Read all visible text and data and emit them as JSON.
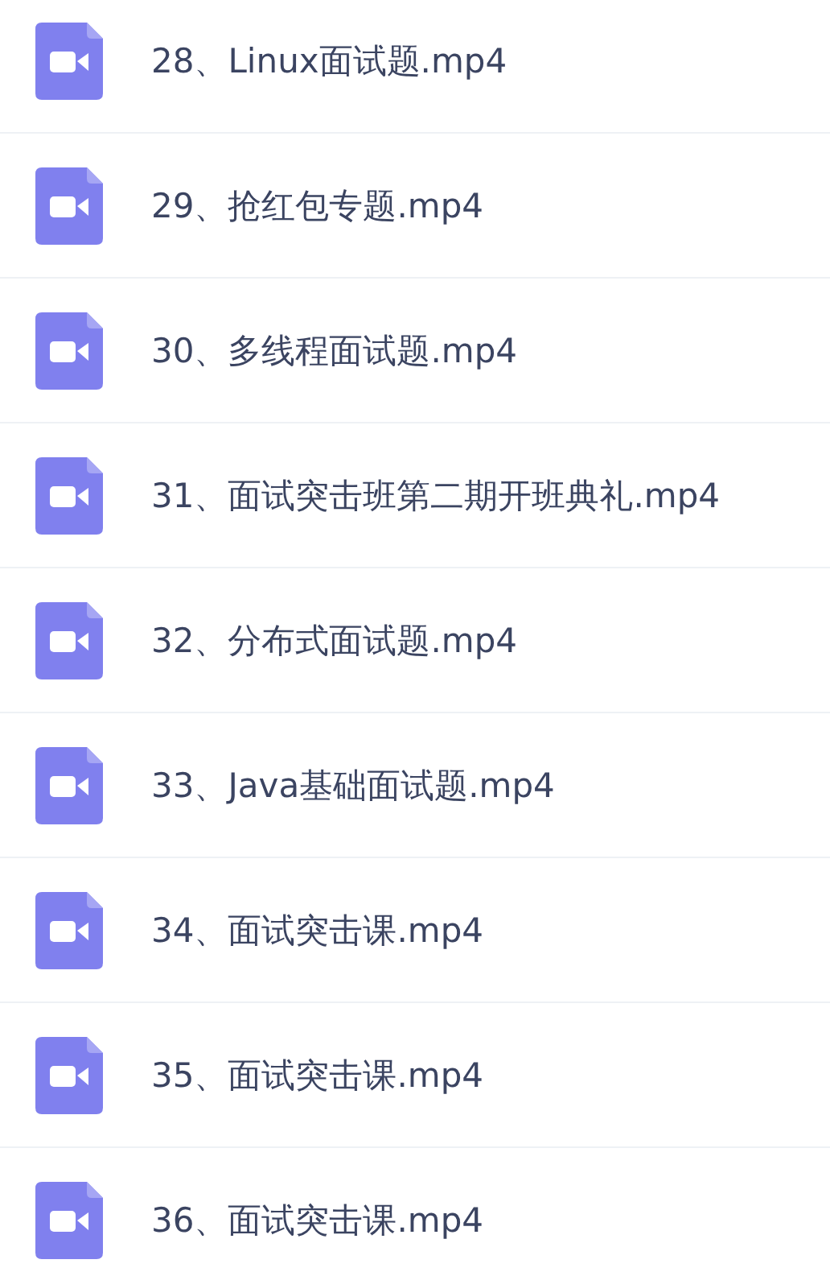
{
  "files": [
    {
      "name": "28、Linux面试题.mp4",
      "kind": "video"
    },
    {
      "name": "29、抢红包专题.mp4",
      "kind": "video"
    },
    {
      "name": "30、多线程面试题.mp4",
      "kind": "video"
    },
    {
      "name": "31、面试突击班第二期开班典礼.mp4",
      "kind": "video"
    },
    {
      "name": "32、分布式面试题.mp4",
      "kind": "video"
    },
    {
      "name": "33、Java基础面试题.mp4",
      "kind": "video"
    },
    {
      "name": "34、面试突击课.mp4",
      "kind": "video"
    },
    {
      "name": "35、面试突击课.mp4",
      "kind": "video"
    },
    {
      "name": "36、面试突击课.mp4",
      "kind": "video"
    }
  ]
}
